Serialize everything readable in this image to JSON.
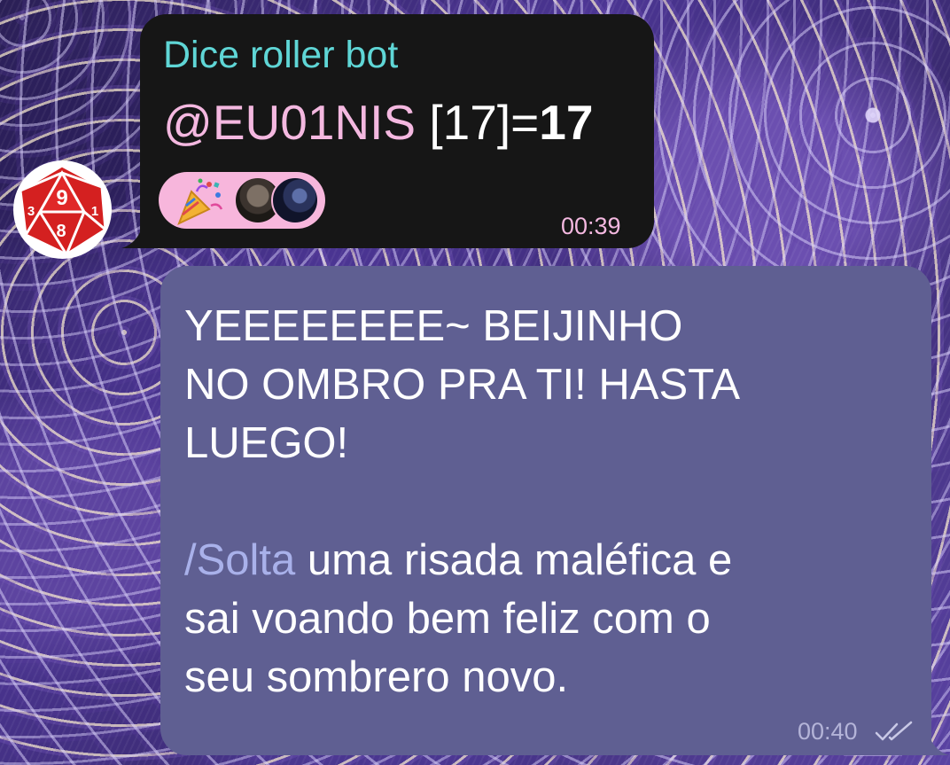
{
  "chat": {
    "incoming": {
      "sender": "Dice roller bot",
      "mention": "@EU01NIS",
      "roll_detail": " [17]=",
      "roll_total": "17",
      "time": "00:39",
      "avatar_icon": "d20-dice-icon",
      "reaction": {
        "emoji_icon": "party-popper-icon",
        "reactors": [
          "reactor-avatar-1",
          "reactor-avatar-2"
        ]
      }
    },
    "outgoing": {
      "line1": "YEEEEEEEE~ BEIJINHO",
      "line2": "NO OMBRO PRA TI! HASTA",
      "line3": "LUEGO!",
      "command": "/Solta",
      "line5_rest": " uma risada maléfica e",
      "line6": "sai voando bem feliz com o",
      "line7": "seu sombrero novo.",
      "time": "00:40",
      "status_icon": "double-check-icon"
    }
  },
  "colors": {
    "bubble_in": "#161616",
    "bubble_out": "#5f5f92",
    "sender": "#5fd6d6",
    "mention": "#f4b8e0",
    "reaction_bg": "#f7b6dc",
    "dice_red": "#d42020"
  }
}
